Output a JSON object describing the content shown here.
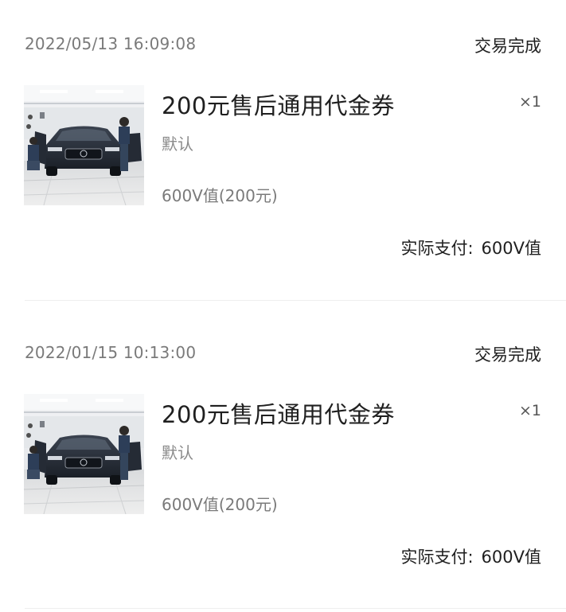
{
  "orders": [
    {
      "time": "2022/05/13 16:09:08",
      "status": "交易完成",
      "product": {
        "name": "200元售后通用代金券",
        "quantity": "×1",
        "spec": "默认",
        "price": "600V值(200元)",
        "image_icon": "car-showroom-photo"
      },
      "paid_label": "实际支付:",
      "paid_value": "600V值"
    },
    {
      "time": "2022/01/15 10:13:00",
      "status": "交易完成",
      "product": {
        "name": "200元售后通用代金券",
        "quantity": "×1",
        "spec": "默认",
        "price": "600V值(200元)",
        "image_icon": "car-showroom-photo"
      },
      "paid_label": "实际支付:",
      "paid_value": "600V值"
    }
  ]
}
